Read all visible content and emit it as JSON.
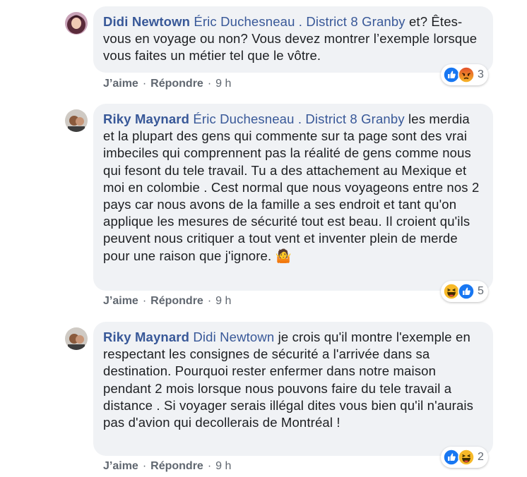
{
  "comments": [
    {
      "author": "Didi Newtown",
      "mention": "Éric Duchesneau . District 8 Granby",
      "body": " et? Êtes-vous en voyage ou non? Vous devez montrer l’exemple lorsque vous faites un métier tel que le vôtre.",
      "emoji": "",
      "actions": {
        "like": "J’aime",
        "reply": "Répondre",
        "time": "9 h"
      },
      "reactions": {
        "icons": [
          "like-icon",
          "angry-icon"
        ],
        "count": "3"
      }
    },
    {
      "author": "Riky Maynard",
      "mention": "Éric Duchesneau . District 8 Granby",
      "body": " les merdia et la plupart des gens qui commente sur ta page sont des vrai imbeciles qui comprennent pas la réalité de gens comme nous qui fesont du tele travail. Tu a des attachement au Mexique et moi en colombie . Cest normal que nous voyageons entre nos 2 pays car nous avons de la famille a ses endroit et tant qu'on applique les mesures de sécurité tout est beau. Il croient qu'ils peuvent nous critiquer a tout vent et inventer plein de merde pour une raison que j'ignore. ",
      "emoji": "🤷",
      "actions": {
        "like": "J’aime",
        "reply": "Répondre",
        "time": "9 h"
      },
      "reactions": {
        "icons": [
          "haha-icon",
          "like-icon"
        ],
        "count": "5"
      }
    },
    {
      "author": "Riky Maynard",
      "mention": "Didi Newtown",
      "body": " je crois qu'il montre l'exemple en respectant les consignes de sécurité a l'arrivée dans sa destination. Pourquoi rester enfermer dans notre maison pendant 2 mois lorsque nous pouvons faire du tele travail a distance . Si voyager serais illégal dites vous bien qu'il n'aurais pas d'avion qui decollerais de Montréal !",
      "emoji": "",
      "actions": {
        "like": "J’aime",
        "reply": "Répondre",
        "time": "9 h"
      },
      "reactions": {
        "icons": [
          "like-icon",
          "haha-icon"
        ],
        "count": "2"
      }
    }
  ],
  "colors": {
    "link": "#385898",
    "bubble": "#f0f2f5",
    "meta": "#606770",
    "like": "#1877f2",
    "haha": "#f7b928",
    "angry": "#e9710f"
  }
}
